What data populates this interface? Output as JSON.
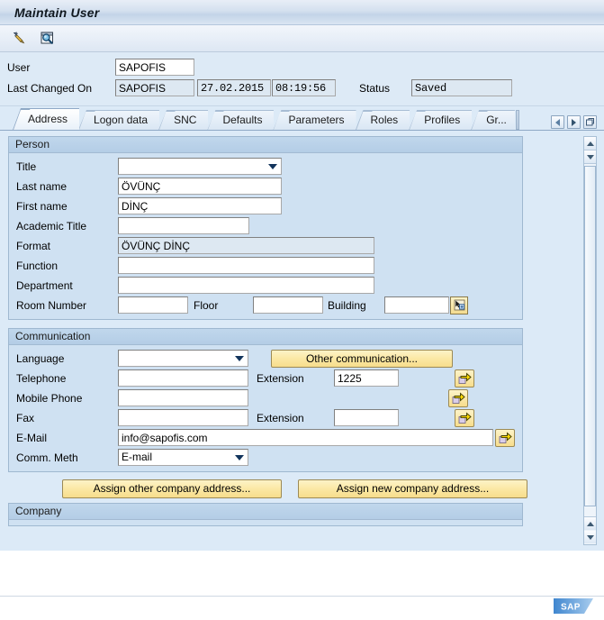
{
  "window": {
    "title": "Maintain User"
  },
  "toolbar": {
    "buttons": [
      {
        "name": "change-icon",
        "label": "Change"
      },
      {
        "name": "display-icon",
        "label": "Display"
      }
    ]
  },
  "header": {
    "user_label": "User",
    "user_value": "SAPOFIS",
    "last_changed_label": "Last Changed On",
    "last_changed_user": "SAPOFIS",
    "last_changed_date": "27.02.2015",
    "last_changed_time": "08:19:56",
    "status_label": "Status",
    "status_value": "Saved"
  },
  "tabs": {
    "items": [
      {
        "label": "Address",
        "selected": true
      },
      {
        "label": "Logon data",
        "selected": false
      },
      {
        "label": "SNC",
        "selected": false
      },
      {
        "label": "Defaults",
        "selected": false
      },
      {
        "label": "Parameters",
        "selected": false
      },
      {
        "label": "Roles",
        "selected": false
      },
      {
        "label": "Profiles",
        "selected": false
      },
      {
        "label": "Gr...",
        "selected": false
      }
    ],
    "nav": {
      "prev": "◄",
      "next": "►",
      "list": "tab-list"
    }
  },
  "person": {
    "section_title": "Person",
    "title_label": "Title",
    "title_value": "",
    "last_name_label": "Last name",
    "last_name_value": "ÖVÜNÇ",
    "first_name_label": "First name",
    "first_name_value": "DİNÇ",
    "academic_title_label": "Academic Title",
    "academic_title_value": "",
    "format_label": "Format",
    "format_value": "ÖVÜNÇ DİNÇ",
    "function_label": "Function",
    "function_value": "",
    "department_label": "Department",
    "department_value": "",
    "room_number_label": "Room Number",
    "room_number_value": "",
    "floor_label": "Floor",
    "floor_value": "",
    "building_label": "Building",
    "building_value": ""
  },
  "communication": {
    "section_title": "Communication",
    "language_label": "Language",
    "language_value": "",
    "other_communication_button": "Other communication...",
    "telephone_label": "Telephone",
    "telephone_value": "",
    "telephone_ext_label": "Extension",
    "telephone_ext_value": "1225",
    "mobile_label": "Mobile Phone",
    "mobile_value": "",
    "fax_label": "Fax",
    "fax_value": "",
    "fax_ext_label": "Extension",
    "fax_ext_value": "",
    "email_label": "E-Mail",
    "email_value": "info@sapofis.com",
    "comm_method_label": "Comm. Meth",
    "comm_method_value": "E-mail"
  },
  "company": {
    "assign_other_button": "Assign other company address...",
    "assign_new_button": "Assign new company address...",
    "section_title": "Company"
  },
  "branding": {
    "logo_text": "SAP"
  },
  "colors": {
    "accent": "#cfe1f2",
    "button_yellow": "#fbe8a4",
    "panel_header": "#b4cde6",
    "sap_blue": "#4a8fd4"
  }
}
